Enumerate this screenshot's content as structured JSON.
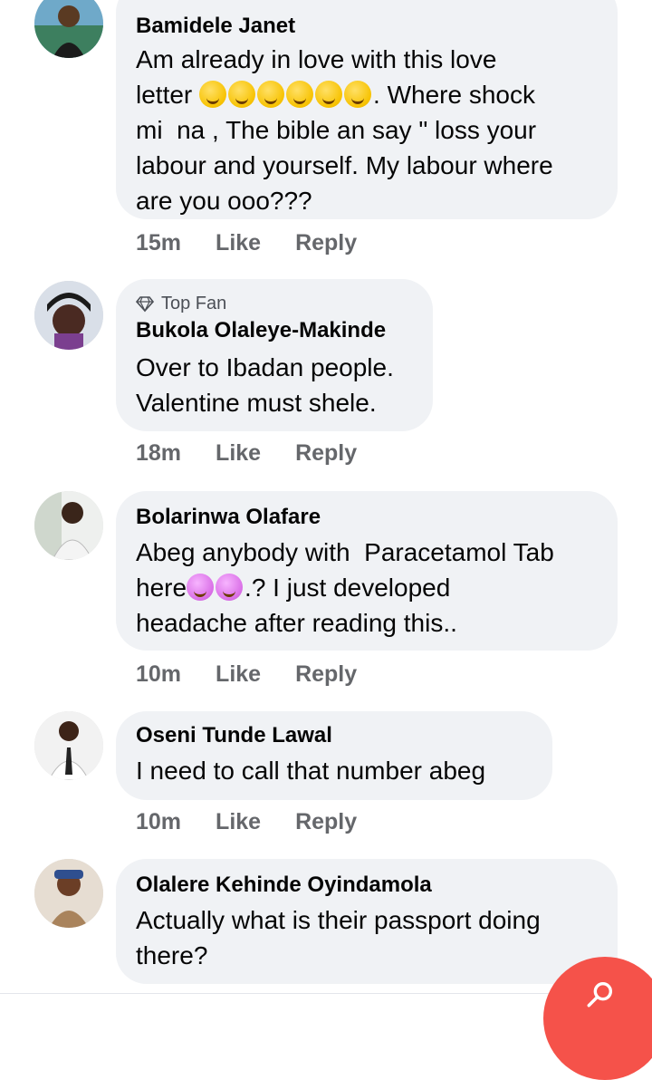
{
  "comments": [
    {
      "author": "Bamidele Janet",
      "badge": "",
      "text_parts": [
        "Am already in love with this love\nletter ",
        ". Where shock\nmi  na , The bible an say \" loss your\nlabour and yourself. My labour where\nare you ooo???"
      ],
      "emoji": "rolling-on-floor-laughing",
      "emoji_count": 6,
      "time": "15m",
      "like": "Like",
      "reply": "Reply"
    },
    {
      "author": "Bukola Olaleye-Makinde",
      "badge": "Top Fan",
      "text": "Over to Ibadan people.\nValentine must shele.",
      "time": "18m",
      "like": "Like",
      "reply": "Reply"
    },
    {
      "author": "Bolarinwa Olafare",
      "badge": "",
      "text_parts": [
        "Abeg anybody with  Paracetamol Tab\nhere",
        ".? I just developed\nheadache after reading this.."
      ],
      "emoji": "tired-face",
      "emoji_count": 2,
      "time": "10m",
      "like": "Like",
      "reply": "Reply"
    },
    {
      "author": "Oseni Tunde Lawal",
      "badge": "",
      "text": "I need to call that number abeg",
      "time": "10m",
      "like": "Like",
      "reply": "Reply"
    },
    {
      "author": "Olalere Kehinde Oyindamola",
      "badge": "",
      "text": "Actually what is their passport doing\nthere?",
      "time": "",
      "like": "",
      "reply": ""
    }
  ],
  "colors": {
    "bubble": "#f0f2f5",
    "meta_text": "#65676b",
    "fab": "#f5524a"
  }
}
